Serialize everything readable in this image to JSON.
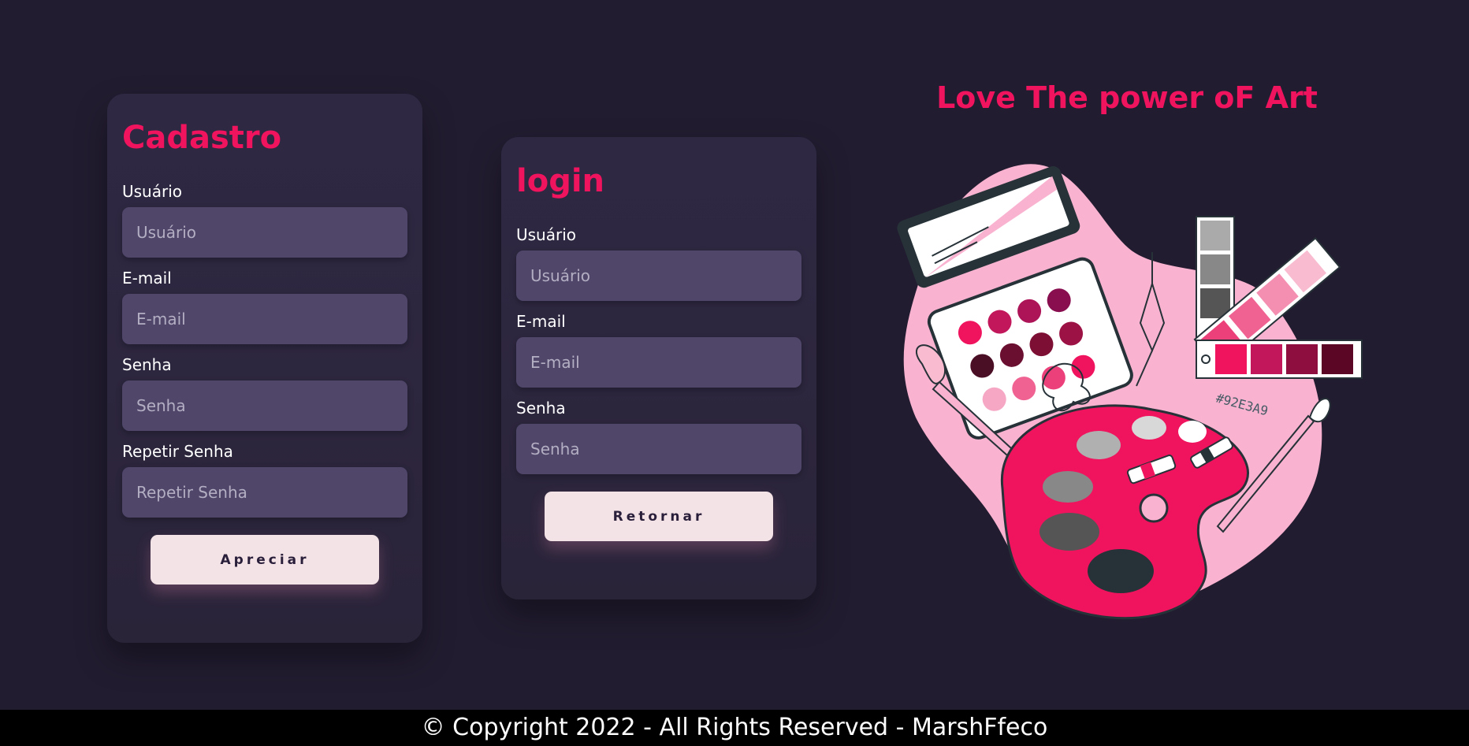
{
  "cadastro": {
    "title": "Cadastro",
    "fields": [
      {
        "label": "Usuário",
        "placeholder": "Usuário"
      },
      {
        "label": "E-mail",
        "placeholder": "E-mail"
      },
      {
        "label": "Senha",
        "placeholder": "Senha"
      },
      {
        "label": "Repetir Senha",
        "placeholder": "Repetir Senha"
      }
    ],
    "button_label": "Apreciar"
  },
  "login": {
    "title": "login",
    "fields": [
      {
        "label": "Usuário",
        "placeholder": "Usuário"
      },
      {
        "label": "E-mail",
        "placeholder": "E-mail"
      },
      {
        "label": "Senha",
        "placeholder": "Senha"
      }
    ],
    "button_label": "Retornar"
  },
  "hero": {
    "title": "Love The power oF Art",
    "swatch_code": "#92E3A9"
  },
  "footer": {
    "text": "© Copyright 2022 - All Rights Reserved - MarshFfeco"
  },
  "colors": {
    "background": "#221c30",
    "card": "#2f2843",
    "accent": "#f0135e",
    "input": "#4f466a",
    "button": "#f4e3e6",
    "illustration_pink": "#f9b3d0"
  }
}
